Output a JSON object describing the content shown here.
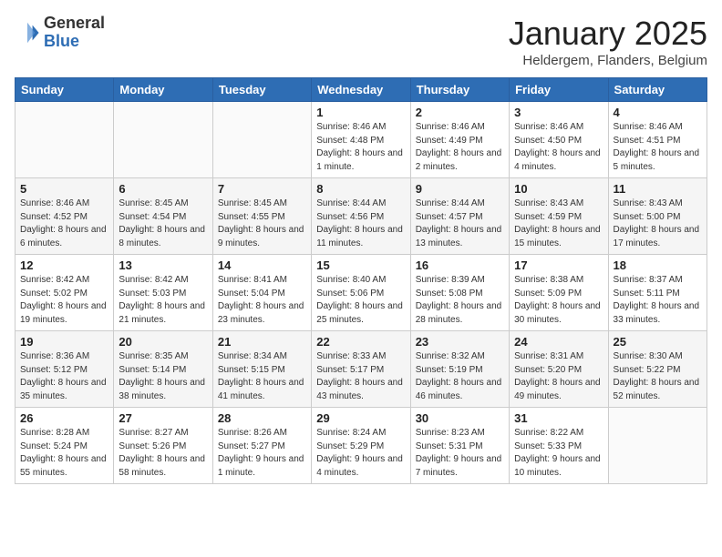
{
  "logo": {
    "general": "General",
    "blue": "Blue"
  },
  "title": "January 2025",
  "location": "Heldergem, Flanders, Belgium",
  "days_of_week": [
    "Sunday",
    "Monday",
    "Tuesday",
    "Wednesday",
    "Thursday",
    "Friday",
    "Saturday"
  ],
  "weeks": [
    [
      {
        "day": "",
        "sunrise": "",
        "sunset": "",
        "daylight": ""
      },
      {
        "day": "",
        "sunrise": "",
        "sunset": "",
        "daylight": ""
      },
      {
        "day": "",
        "sunrise": "",
        "sunset": "",
        "daylight": ""
      },
      {
        "day": "1",
        "sunrise": "Sunrise: 8:46 AM",
        "sunset": "Sunset: 4:48 PM",
        "daylight": "Daylight: 8 hours and 1 minute."
      },
      {
        "day": "2",
        "sunrise": "Sunrise: 8:46 AM",
        "sunset": "Sunset: 4:49 PM",
        "daylight": "Daylight: 8 hours and 2 minutes."
      },
      {
        "day": "3",
        "sunrise": "Sunrise: 8:46 AM",
        "sunset": "Sunset: 4:50 PM",
        "daylight": "Daylight: 8 hours and 4 minutes."
      },
      {
        "day": "4",
        "sunrise": "Sunrise: 8:46 AM",
        "sunset": "Sunset: 4:51 PM",
        "daylight": "Daylight: 8 hours and 5 minutes."
      }
    ],
    [
      {
        "day": "5",
        "sunrise": "Sunrise: 8:46 AM",
        "sunset": "Sunset: 4:52 PM",
        "daylight": "Daylight: 8 hours and 6 minutes."
      },
      {
        "day": "6",
        "sunrise": "Sunrise: 8:45 AM",
        "sunset": "Sunset: 4:54 PM",
        "daylight": "Daylight: 8 hours and 8 minutes."
      },
      {
        "day": "7",
        "sunrise": "Sunrise: 8:45 AM",
        "sunset": "Sunset: 4:55 PM",
        "daylight": "Daylight: 8 hours and 9 minutes."
      },
      {
        "day": "8",
        "sunrise": "Sunrise: 8:44 AM",
        "sunset": "Sunset: 4:56 PM",
        "daylight": "Daylight: 8 hours and 11 minutes."
      },
      {
        "day": "9",
        "sunrise": "Sunrise: 8:44 AM",
        "sunset": "Sunset: 4:57 PM",
        "daylight": "Daylight: 8 hours and 13 minutes."
      },
      {
        "day": "10",
        "sunrise": "Sunrise: 8:43 AM",
        "sunset": "Sunset: 4:59 PM",
        "daylight": "Daylight: 8 hours and 15 minutes."
      },
      {
        "day": "11",
        "sunrise": "Sunrise: 8:43 AM",
        "sunset": "Sunset: 5:00 PM",
        "daylight": "Daylight: 8 hours and 17 minutes."
      }
    ],
    [
      {
        "day": "12",
        "sunrise": "Sunrise: 8:42 AM",
        "sunset": "Sunset: 5:02 PM",
        "daylight": "Daylight: 8 hours and 19 minutes."
      },
      {
        "day": "13",
        "sunrise": "Sunrise: 8:42 AM",
        "sunset": "Sunset: 5:03 PM",
        "daylight": "Daylight: 8 hours and 21 minutes."
      },
      {
        "day": "14",
        "sunrise": "Sunrise: 8:41 AM",
        "sunset": "Sunset: 5:04 PM",
        "daylight": "Daylight: 8 hours and 23 minutes."
      },
      {
        "day": "15",
        "sunrise": "Sunrise: 8:40 AM",
        "sunset": "Sunset: 5:06 PM",
        "daylight": "Daylight: 8 hours and 25 minutes."
      },
      {
        "day": "16",
        "sunrise": "Sunrise: 8:39 AM",
        "sunset": "Sunset: 5:08 PM",
        "daylight": "Daylight: 8 hours and 28 minutes."
      },
      {
        "day": "17",
        "sunrise": "Sunrise: 8:38 AM",
        "sunset": "Sunset: 5:09 PM",
        "daylight": "Daylight: 8 hours and 30 minutes."
      },
      {
        "day": "18",
        "sunrise": "Sunrise: 8:37 AM",
        "sunset": "Sunset: 5:11 PM",
        "daylight": "Daylight: 8 hours and 33 minutes."
      }
    ],
    [
      {
        "day": "19",
        "sunrise": "Sunrise: 8:36 AM",
        "sunset": "Sunset: 5:12 PM",
        "daylight": "Daylight: 8 hours and 35 minutes."
      },
      {
        "day": "20",
        "sunrise": "Sunrise: 8:35 AM",
        "sunset": "Sunset: 5:14 PM",
        "daylight": "Daylight: 8 hours and 38 minutes."
      },
      {
        "day": "21",
        "sunrise": "Sunrise: 8:34 AM",
        "sunset": "Sunset: 5:15 PM",
        "daylight": "Daylight: 8 hours and 41 minutes."
      },
      {
        "day": "22",
        "sunrise": "Sunrise: 8:33 AM",
        "sunset": "Sunset: 5:17 PM",
        "daylight": "Daylight: 8 hours and 43 minutes."
      },
      {
        "day": "23",
        "sunrise": "Sunrise: 8:32 AM",
        "sunset": "Sunset: 5:19 PM",
        "daylight": "Daylight: 8 hours and 46 minutes."
      },
      {
        "day": "24",
        "sunrise": "Sunrise: 8:31 AM",
        "sunset": "Sunset: 5:20 PM",
        "daylight": "Daylight: 8 hours and 49 minutes."
      },
      {
        "day": "25",
        "sunrise": "Sunrise: 8:30 AM",
        "sunset": "Sunset: 5:22 PM",
        "daylight": "Daylight: 8 hours and 52 minutes."
      }
    ],
    [
      {
        "day": "26",
        "sunrise": "Sunrise: 8:28 AM",
        "sunset": "Sunset: 5:24 PM",
        "daylight": "Daylight: 8 hours and 55 minutes."
      },
      {
        "day": "27",
        "sunrise": "Sunrise: 8:27 AM",
        "sunset": "Sunset: 5:26 PM",
        "daylight": "Daylight: 8 hours and 58 minutes."
      },
      {
        "day": "28",
        "sunrise": "Sunrise: 8:26 AM",
        "sunset": "Sunset: 5:27 PM",
        "daylight": "Daylight: 9 hours and 1 minute."
      },
      {
        "day": "29",
        "sunrise": "Sunrise: 8:24 AM",
        "sunset": "Sunset: 5:29 PM",
        "daylight": "Daylight: 9 hours and 4 minutes."
      },
      {
        "day": "30",
        "sunrise": "Sunrise: 8:23 AM",
        "sunset": "Sunset: 5:31 PM",
        "daylight": "Daylight: 9 hours and 7 minutes."
      },
      {
        "day": "31",
        "sunrise": "Sunrise: 8:22 AM",
        "sunset": "Sunset: 5:33 PM",
        "daylight": "Daylight: 9 hours and 10 minutes."
      },
      {
        "day": "",
        "sunrise": "",
        "sunset": "",
        "daylight": ""
      }
    ]
  ]
}
